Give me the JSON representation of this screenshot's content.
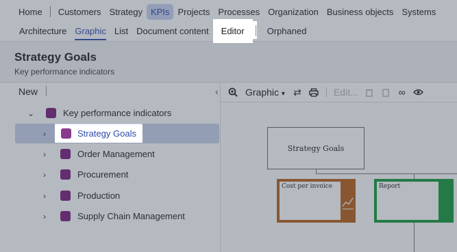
{
  "nav": {
    "row1": [
      "Home",
      "Customers",
      "Strategy",
      "KPIs",
      "Projects",
      "Processes",
      "Organization",
      "Business objects",
      "Systems"
    ],
    "row2": [
      "Architecture",
      "Graphic",
      "List",
      "Document content",
      "Editor",
      "Orphaned"
    ]
  },
  "header": {
    "title": "Strategy Goals",
    "subtitle": "Key performance indicators"
  },
  "tree": {
    "new_label": "New",
    "root": "Key performance indicators",
    "items": [
      "Strategy Goals",
      "Order Management",
      "Procurement",
      "Production",
      "Supply Chain Management"
    ]
  },
  "canvas_toolbar": {
    "view_label": "Graphic",
    "edit_label": "Edit..."
  },
  "diagram": {
    "boxes": [
      "Strategy Goals",
      "Cost per invoice",
      "Report"
    ]
  },
  "colors": {
    "accent": "#2c49a8",
    "folder": "#7a1f7e",
    "cost_box": "#b7621a",
    "report_box": "#149a3a"
  }
}
